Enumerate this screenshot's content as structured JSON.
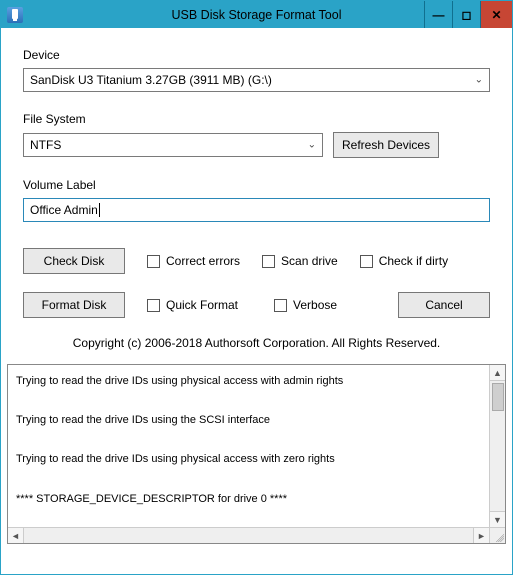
{
  "window": {
    "title": "USB Disk Storage Format Tool"
  },
  "labels": {
    "device": "Device",
    "filesystem": "File System",
    "volume": "Volume Label"
  },
  "device": {
    "selected": "SanDisk U3 Titanium 3.27GB (3911 MB)  (G:\\)"
  },
  "filesystem": {
    "selected": "NTFS"
  },
  "volume": {
    "value": "Office Admin"
  },
  "buttons": {
    "refresh": "Refresh Devices",
    "check": "Check Disk",
    "format": "Format Disk",
    "cancel": "Cancel"
  },
  "checks": {
    "correct": "Correct errors",
    "scan": "Scan drive",
    "dirty": "Check if dirty",
    "quick": "Quick Format",
    "verbose": "Verbose"
  },
  "copyright": "Copyright (c) 2006-2018 Authorsoft Corporation. All Rights Reserved.",
  "log": {
    "lines": [
      "Trying to read the drive IDs using physical access with admin rights",
      "Trying to read the drive IDs using the SCSI interface",
      "Trying to read the drive IDs using physical access with zero rights",
      "**** STORAGE_DEVICE_DESCRIPTOR for drive 0 ****"
    ]
  }
}
